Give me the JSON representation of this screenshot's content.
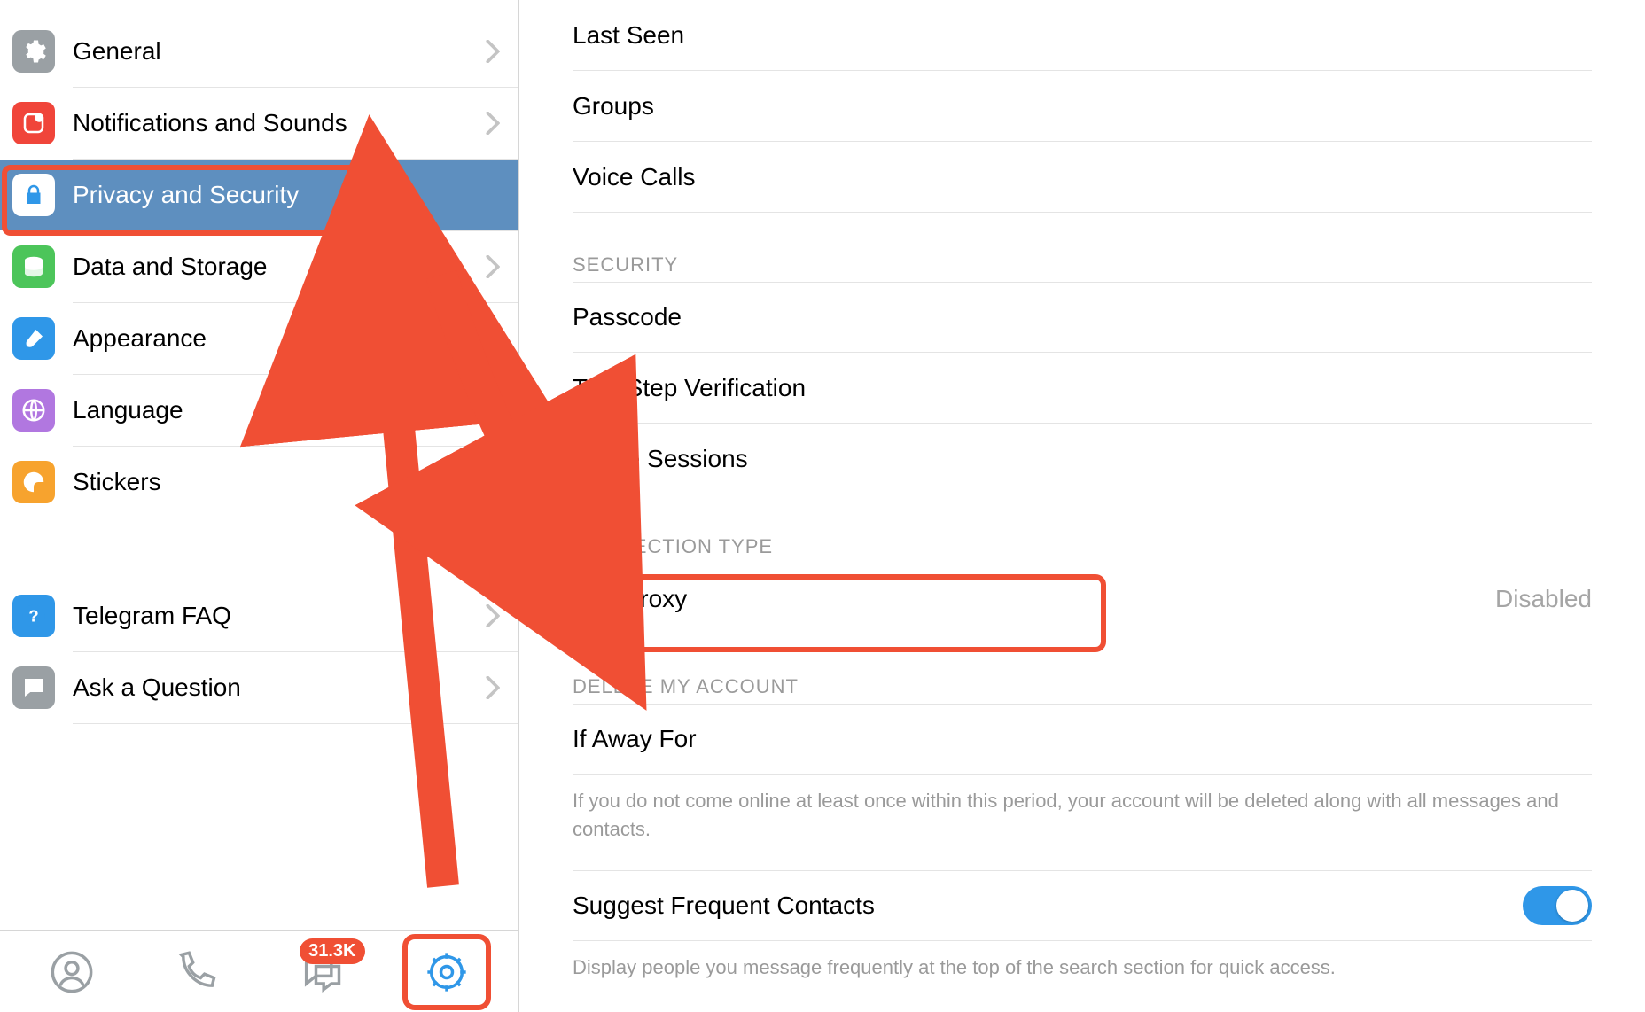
{
  "sidebar": {
    "items": [
      {
        "key": "general",
        "label": "General",
        "color": "#9aa0a4",
        "icon": "gear"
      },
      {
        "key": "notifications",
        "label": "Notifications and Sounds",
        "color": "#f0453a",
        "icon": "bell"
      },
      {
        "key": "privacy",
        "label": "Privacy and Security",
        "color": "#2f97e8",
        "icon": "lock",
        "selected": true
      },
      {
        "key": "data",
        "label": "Data and Storage",
        "color": "#4cc55a",
        "icon": "stack"
      },
      {
        "key": "appearance",
        "label": "Appearance",
        "color": "#2f97e8",
        "icon": "brush"
      },
      {
        "key": "language",
        "label": "Language",
        "color": "#b177e0",
        "icon": "globe"
      },
      {
        "key": "stickers",
        "label": "Stickers",
        "color": "#f7a32e",
        "icon": "sticker"
      }
    ],
    "support": [
      {
        "key": "faq",
        "label": "Telegram FAQ",
        "color": "#2f97e8",
        "icon": "help"
      },
      {
        "key": "ask",
        "label": "Ask a Question",
        "color": "#9aa0a4",
        "icon": "chat"
      }
    ]
  },
  "tabbar": {
    "badge": "31.3K",
    "active": "settings"
  },
  "content": {
    "privacy_rows": [
      {
        "label": "Last Seen"
      },
      {
        "label": "Groups"
      },
      {
        "label": "Voice Calls"
      }
    ],
    "security_header": "SECURITY",
    "security_rows": [
      {
        "label": "Passcode"
      },
      {
        "label": "Two-Step Verification"
      },
      {
        "label": "Active Sessions"
      }
    ],
    "connection_header": "CONNECTION TYPE",
    "connection_row": {
      "label": "Use Proxy",
      "value": "Disabled"
    },
    "delete_header": "DELETE MY ACCOUNT",
    "delete_row": {
      "label": "If Away For"
    },
    "delete_descr": "If you do not come online at least once within this period, your account will be deleted along with all messages and contacts.",
    "suggest_row": {
      "label": "Suggest Frequent Contacts",
      "toggle": true
    },
    "suggest_descr": "Display people you message frequently at the top of the search section for quick access."
  },
  "annotations": {
    "highlight_color": "#f04f34"
  }
}
